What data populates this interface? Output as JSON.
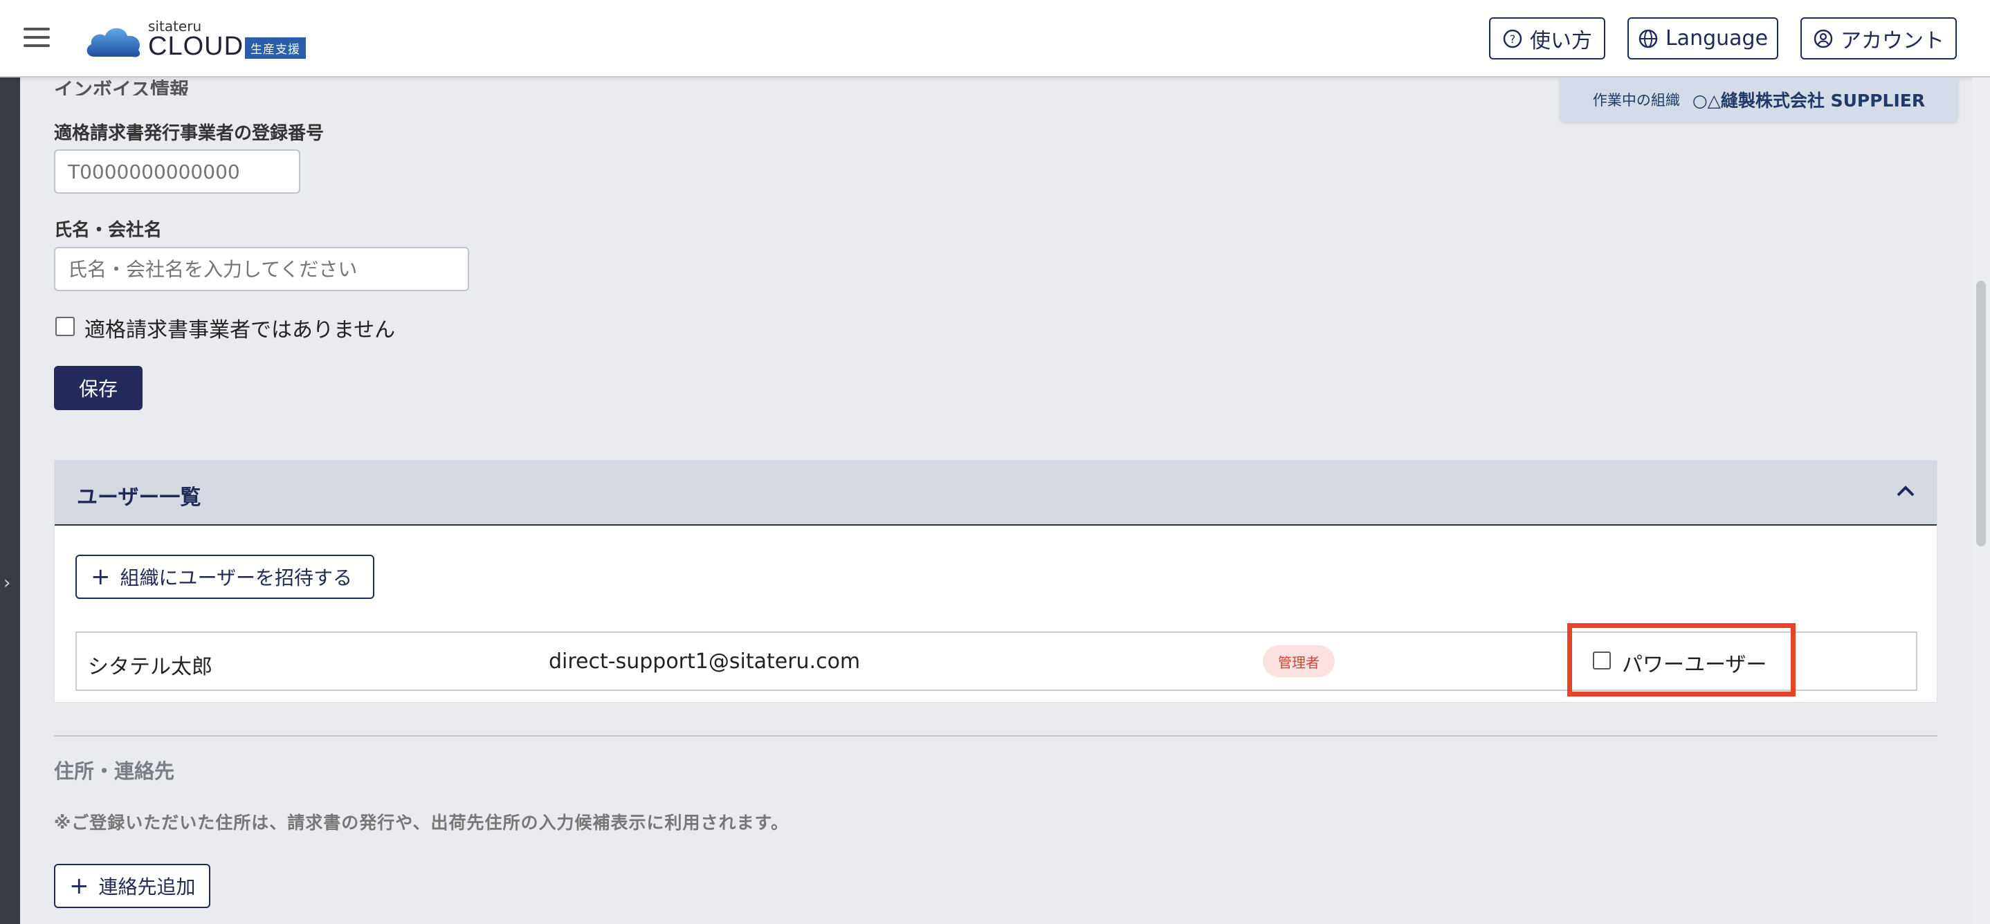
{
  "header": {
    "logo_small": "sitateru",
    "logo_big": "CLOUD",
    "logo_badge": "生産支援",
    "help_label": "使い方",
    "language_label": "Language",
    "account_label": "アカウント"
  },
  "org": {
    "label": "作業中の組織",
    "name": "○△縫製株式会社 SUPPLIER"
  },
  "invoice": {
    "section_title": "インボイス情報",
    "reg_number_label": "適格請求書発行事業者の登録番号",
    "reg_number_placeholder": "T0000000000000",
    "name_label": "氏名・会社名",
    "name_placeholder": "氏名・会社名を入力してください",
    "not_registered_label": "適格請求書事業者ではありません",
    "save_label": "保存"
  },
  "users": {
    "title": "ユーザー一覧",
    "invite_label": "組織にユーザーを招待する",
    "rows": [
      {
        "name": "シタテル太郎",
        "email": "direct-support1@sitateru.com",
        "role": "管理者",
        "power_user_label": "パワーユーザー"
      }
    ]
  },
  "address": {
    "title": "住所・連絡先",
    "note": "※ご登録いただいた住所は、請求書の発行や、出荷先住所の入力候補表示に利用されます。",
    "add_contact_label": "連絡先追加"
  },
  "colors": {
    "navy": "#232a5c",
    "highlight": "#e6432a",
    "badge_bg": "#fbe2e0",
    "badge_text": "#d0453b"
  }
}
